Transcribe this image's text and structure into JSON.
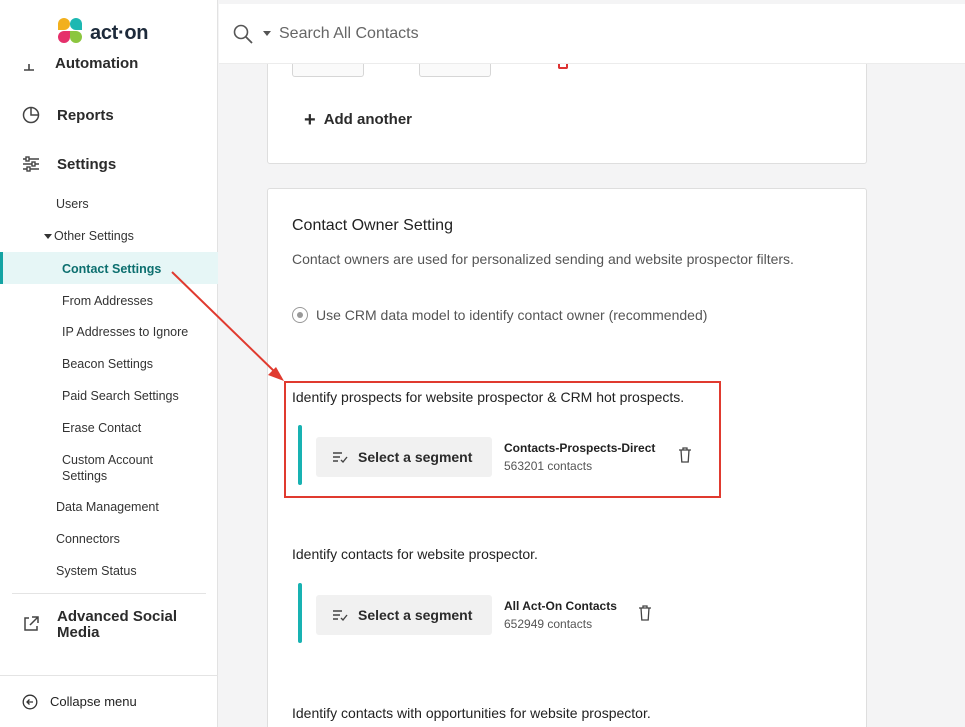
{
  "brand": {
    "logo_text": "act·on"
  },
  "sidebar": {
    "partial_item": "Automation",
    "reports": "Reports",
    "settings": "Settings",
    "settings_children": {
      "users": "Users",
      "other_settings": "Other Settings",
      "other_children": [
        "Contact Settings",
        "From Addresses",
        "IP Addresses to Ignore",
        "Beacon Settings",
        "Paid Search Settings",
        "Erase Contact",
        "Custom Account Settings"
      ],
      "data_management": "Data Management",
      "connectors": "Connectors",
      "system_status": "System Status"
    },
    "advanced_social": "Advanced Social Media",
    "collapse": "Collapse menu"
  },
  "topbar": {
    "search_placeholder": "Search All Contacts"
  },
  "card1": {
    "add_another": "Add another"
  },
  "contact_owner": {
    "title": "Contact Owner Setting",
    "description": "Contact owners are used for personalized sending and website prospector filters.",
    "radio_label": "Use CRM data model to identify contact owner (recommended)",
    "sections": [
      {
        "label": "Identify prospects for website prospector & CRM hot prospects.",
        "button": "Select a segment",
        "segment_name": "Contacts-Prospects-Direct",
        "segment_count": "563201 contacts"
      },
      {
        "label": "Identify contacts for website prospector.",
        "button": "Select a segment",
        "segment_name": "All Act-On Contacts",
        "segment_count": "652949 contacts"
      },
      {
        "label": "Identify contacts with opportunities for website prospector."
      }
    ]
  },
  "colors": {
    "accent": "#14a3a3",
    "highlight": "#e03a2f",
    "active_bg": "#e6f6f6"
  }
}
